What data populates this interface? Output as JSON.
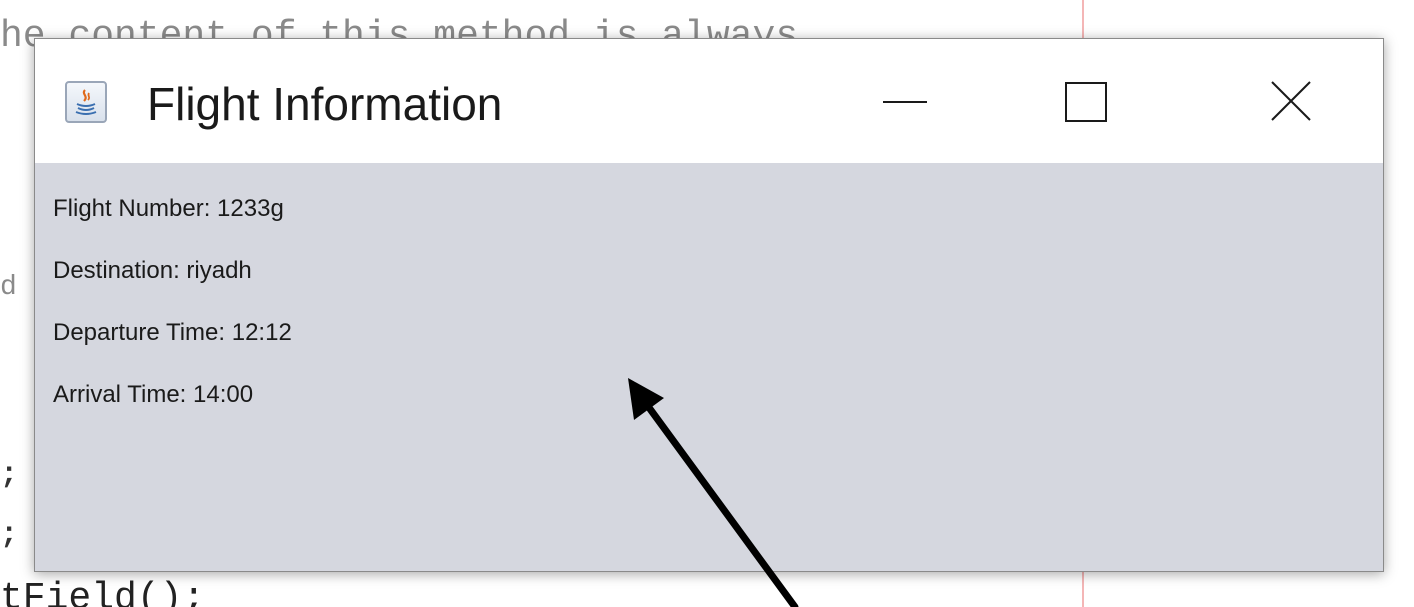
{
  "editor": {
    "lines": [
      "he content of this method is always",
      "d",
      ";",
      ";",
      "tField();"
    ]
  },
  "window": {
    "title": "Flight Information",
    "icon": "java-icon",
    "controls": [
      "minimize-icon",
      "maximize-icon",
      "close-icon"
    ]
  },
  "flight": {
    "lines": [
      "Flight Number: 1233g",
      "Destination: riyadh",
      "Departure Time: 12:12",
      "Arrival Time: 14:00"
    ]
  },
  "colors": {
    "content_bg": "#d5d7df",
    "titlebar_bg": "#ffffff",
    "arrow": "#000000"
  }
}
